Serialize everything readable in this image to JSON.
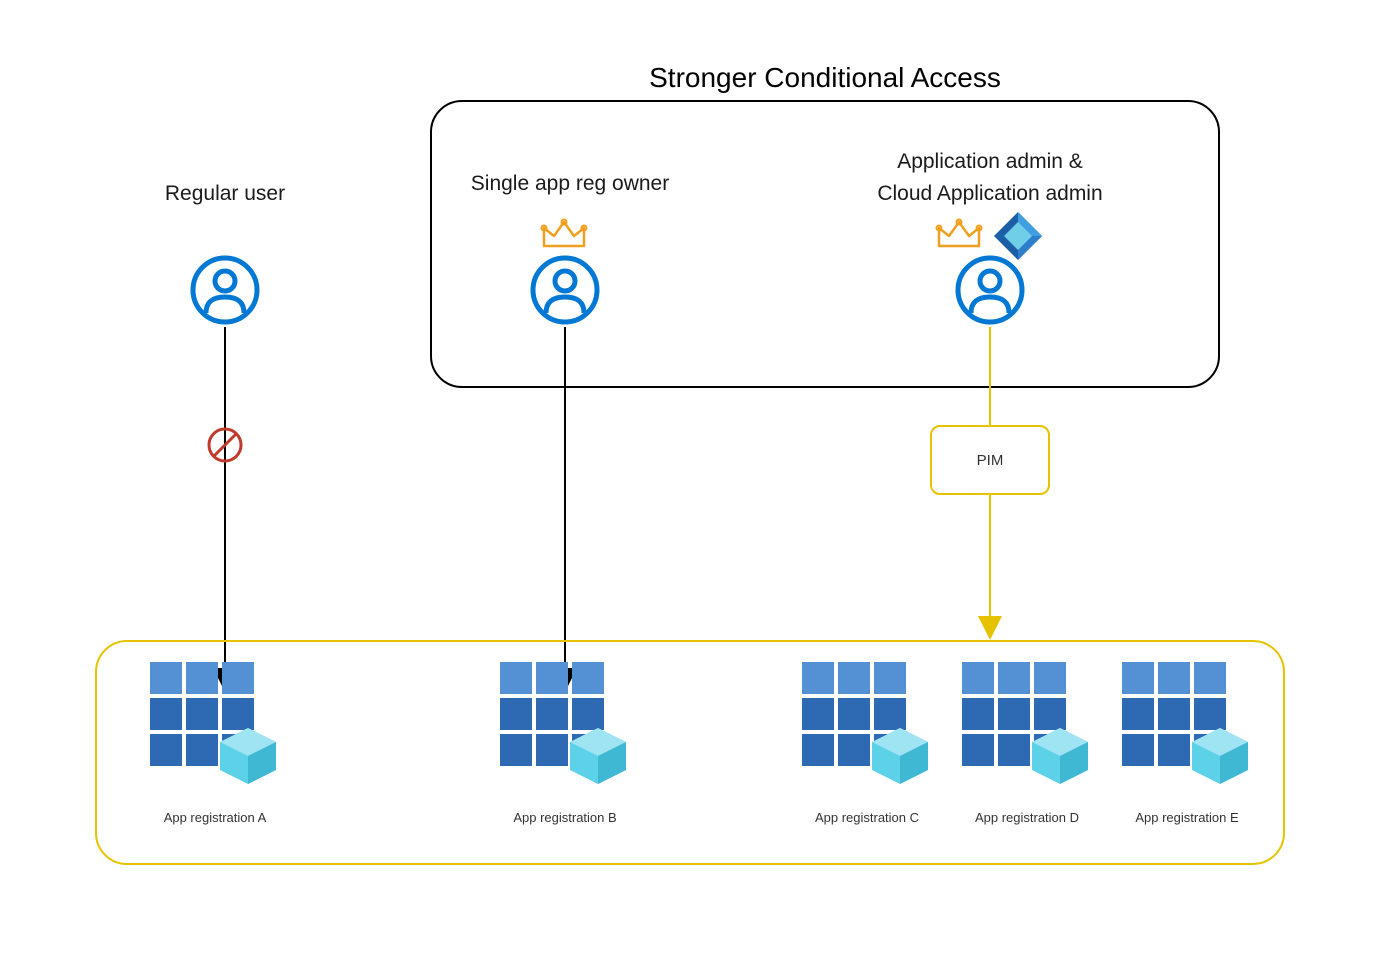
{
  "title": "Stronger Conditional Access",
  "users": {
    "regular": {
      "label": "Regular user"
    },
    "owner": {
      "label": "Single app reg owner"
    },
    "admin": {
      "label_line1": "Application admin &",
      "label_line2": "Cloud Application admin"
    }
  },
  "pim": {
    "label": "PIM"
  },
  "apps": {
    "a": {
      "label": "App registration A"
    },
    "b": {
      "label": "App registration B"
    },
    "c": {
      "label": "App registration C"
    },
    "d": {
      "label": "App registration D"
    },
    "e": {
      "label": "App registration E"
    }
  },
  "colors": {
    "azure_blue": "#0078d4",
    "crown_orange": "#f0a020",
    "prohibit_red": "#c0392b",
    "pim_yellow": "#e6c200",
    "grid_blue_dark": "#2d6ab3",
    "grid_blue_light": "#5490d4",
    "hex_cyan": "#5dd1e8"
  }
}
